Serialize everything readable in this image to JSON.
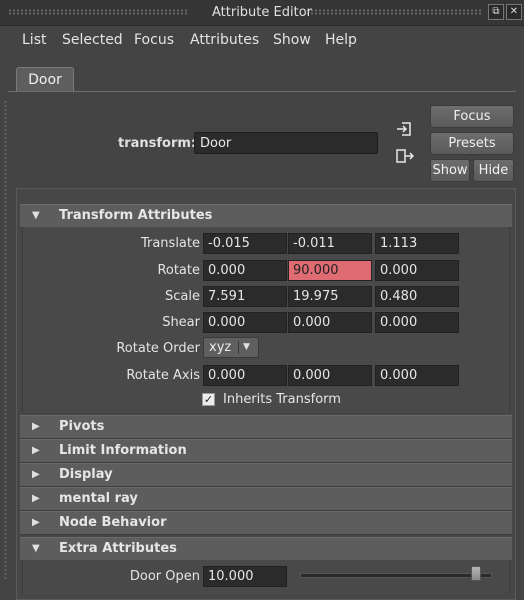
{
  "window": {
    "title": "Attribute Editor"
  },
  "menu": {
    "items": [
      "List",
      "Selected",
      "Focus",
      "Attributes",
      "Show",
      "Help"
    ]
  },
  "tabs": [
    {
      "label": "Door"
    }
  ],
  "node": {
    "label": "transform:",
    "value": "Door"
  },
  "buttons": {
    "focus": "Focus",
    "presets": "Presets",
    "show": "Show",
    "hide": "Hide"
  },
  "sections": {
    "transform": {
      "label": "Transform Attributes",
      "expanded": true,
      "translate": {
        "label": "Translate",
        "values": [
          "-0.015",
          "-0.011",
          "1.113"
        ]
      },
      "rotate": {
        "label": "Rotate",
        "values": [
          "0.000",
          "90.000",
          "0.000"
        ]
      },
      "scale": {
        "label": "Scale",
        "values": [
          "7.591",
          "19.975",
          "0.480"
        ]
      },
      "shear": {
        "label": "Shear",
        "values": [
          "0.000",
          "0.000",
          "0.000"
        ]
      },
      "rotate_order": {
        "label": "Rotate Order",
        "value": "xyz"
      },
      "rotate_axis": {
        "label": "Rotate Axis",
        "values": [
          "0.000",
          "0.000",
          "0.000"
        ]
      },
      "inherits_transform": {
        "label": "Inherits Transform",
        "checked": true
      }
    },
    "pivots": {
      "label": "Pivots",
      "expanded": false
    },
    "limit_information": {
      "label": "Limit Information",
      "expanded": false
    },
    "display": {
      "label": "Display",
      "expanded": false
    },
    "mental_ray": {
      "label": "mental ray",
      "expanded": false
    },
    "node_behavior": {
      "label": "Node Behavior",
      "expanded": false
    },
    "extra_attributes": {
      "label": "Extra Attributes",
      "expanded": true,
      "door_open": {
        "label": "Door Open",
        "value": "10.000",
        "slider_fraction": 0.95
      }
    }
  },
  "colors": {
    "highlight_field": "#df6c73",
    "panel_bg": "#444444",
    "field_bg": "#2b2b2b"
  },
  "icons": {
    "check": "✓",
    "arrow_expanded": "▼",
    "arrow_collapsed": "▶",
    "dropdown": "▼",
    "float": "⧉",
    "close": "✕"
  }
}
